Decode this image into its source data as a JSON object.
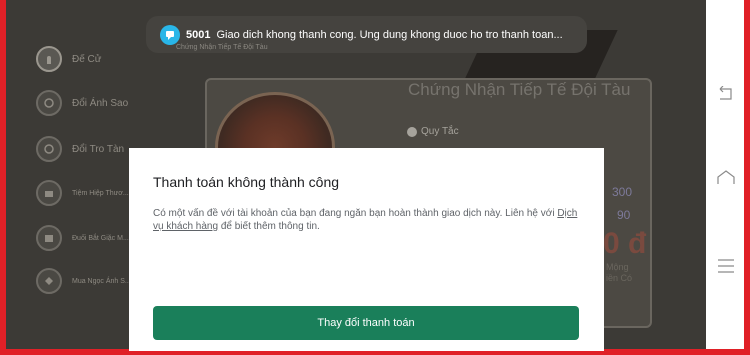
{
  "toast": {
    "code": "5001",
    "message": "Giao dich khong thanh cong. Ung dung khong duoc ho tro thanh toan...",
    "subtext": "Chứng Nhận Tiếp Tế Đội Tàu"
  },
  "game": {
    "sidebar": [
      {
        "label": "Đế Cử"
      },
      {
        "label": "Đổi Ánh Sao"
      },
      {
        "label": "Đổi Tro Tàn"
      },
      {
        "label": "Tiệm Hiệp Thươ..."
      },
      {
        "label": "Đuối Bắt Giặc M..."
      },
      {
        "label": "Mua Ngọc Ánh S..."
      }
    ],
    "panel_title": "Chứng Nhận Tiếp Tế Đội Tàu",
    "rule_label": "Quy Tắc",
    "number_a": "300",
    "number_b": "90",
    "price": "0 đ",
    "mong_label": "Mộng",
    "con_label": "iền Có"
  },
  "dialog": {
    "title": "Thanh toán không thành công",
    "body_prefix": "Có một vấn đề với tài khoản của bạn đang ngăn bạn hoàn thành giao dịch này. Liên hệ với ",
    "link": "Dịch vụ khách hàng",
    "body_suffix": " để biết thêm thông tin.",
    "button": "Thay đổi thanh toán"
  },
  "colors": {
    "frame": "#e02027",
    "button": "#1a7f5a",
    "toast_icon": "#29b6e8"
  }
}
